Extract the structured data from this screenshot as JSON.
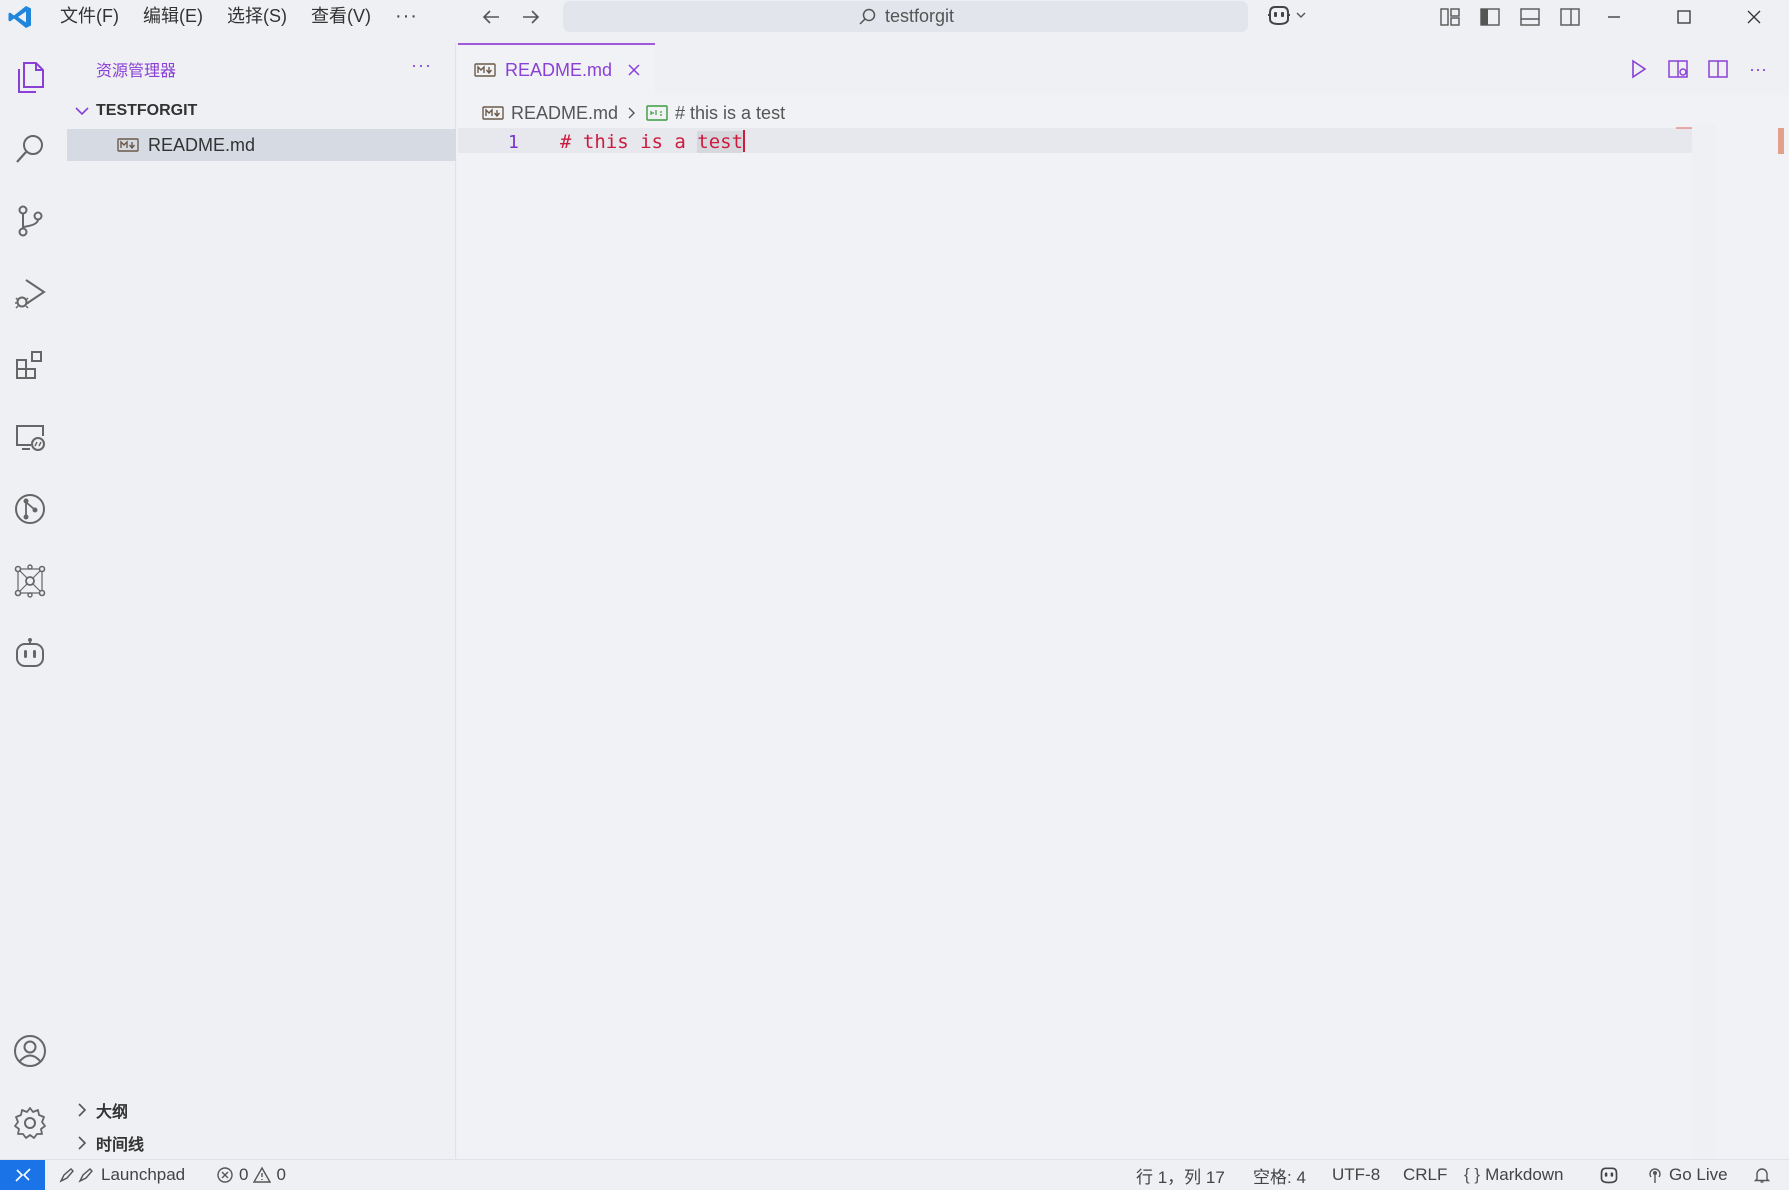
{
  "titlebar": {
    "menu": [
      "文件(F)",
      "编辑(E)",
      "选择(S)",
      "查看(V)"
    ],
    "menu_more": "···",
    "search_text": "testforgit"
  },
  "sidebar": {
    "title": "资源管理器",
    "more": "···",
    "folder": "TESTFORGIT",
    "file": "README.md",
    "outline": "大纲",
    "timeline": "时间线"
  },
  "editor": {
    "tab_label": "README.md",
    "breadcrumb_file": "README.md",
    "breadcrumb_symbol": "# this is a test",
    "line_number": "1",
    "code_prefix": "# this is a ",
    "code_highlight": "test",
    "more": "···"
  },
  "statusbar": {
    "launchpad": "Launchpad",
    "errors": "0",
    "warnings": "0",
    "position": "行 1，列 17",
    "spaces": "空格: 4",
    "encoding": "UTF-8",
    "eol": "CRLF",
    "language": "Markdown",
    "go_live": "Go Live"
  },
  "colors": {
    "accent": "#8a3fd6",
    "remote": "#1a74e8",
    "code_heading": "#cc1b3d"
  }
}
